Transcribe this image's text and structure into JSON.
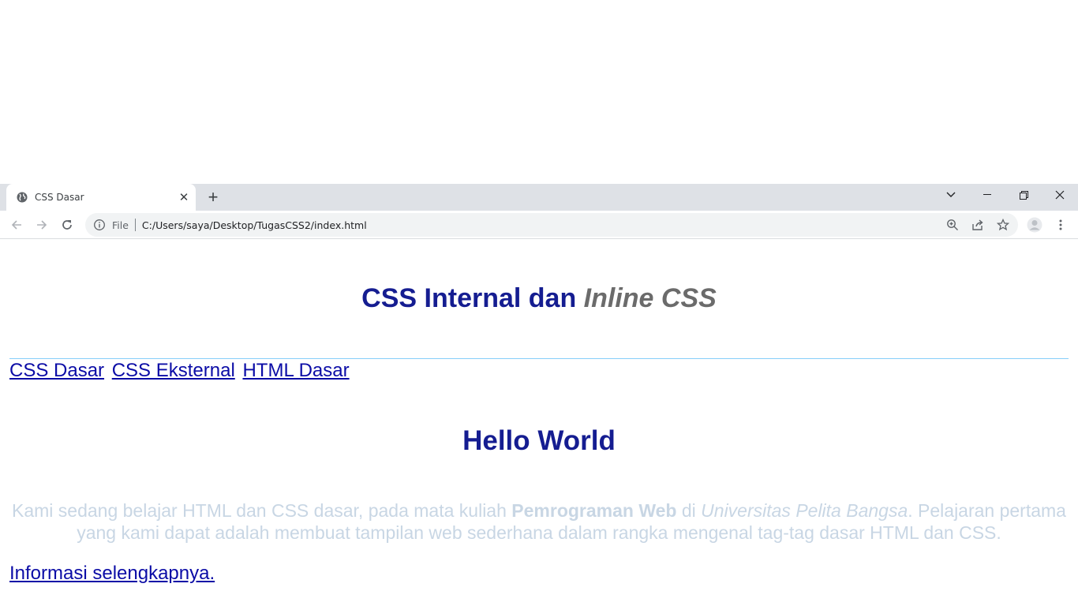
{
  "browser": {
    "tab": {
      "title": "CSS Dasar",
      "icon": "globe-icon"
    },
    "omnibox": {
      "scheme_label": "File",
      "url": "C:/Users/saya/Desktop/TugasCSS2/index.html"
    }
  },
  "page": {
    "title_part1": "CSS Internal dan ",
    "title_part2": "Inline CSS",
    "nav_links": [
      "CSS Dasar",
      "CSS Eksternal",
      "HTML Dasar"
    ],
    "heading": "Hello World",
    "paragraph": {
      "text1": "Kami sedang belajar HTML dan CSS dasar, pada mata kuliah ",
      "bold": "Pemrograman Web",
      "text2": " di ",
      "italic": "Universitas Pelita Bangsa",
      "text3": ". Pelajaran pertama yang kami dapat adalah membuat tampilan web sederhana dalam rangka mengenal tag-tag dasar HTML dan CSS."
    },
    "more_link": "Informasi selengkapnya."
  },
  "colors": {
    "heading": "#151d91",
    "title_italic": "#6b6b6b",
    "link": "#0b0ca6",
    "paragraph": "#c8d6e4",
    "rule": "#87cefa",
    "tabstrip": "#dee1e6"
  }
}
